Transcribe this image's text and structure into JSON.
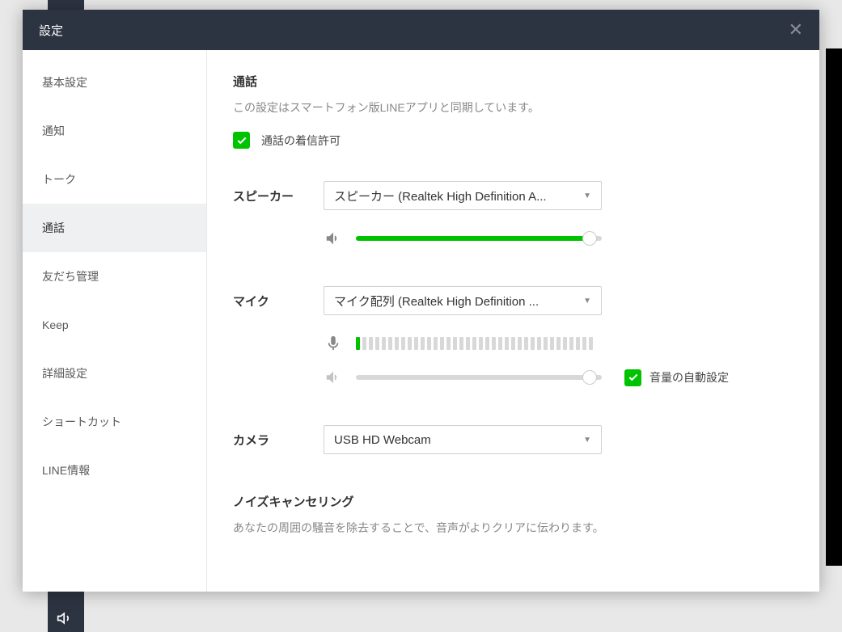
{
  "modal": {
    "title": "設定"
  },
  "sidebar": {
    "items": [
      {
        "label": "基本設定",
        "active": false
      },
      {
        "label": "通知",
        "active": false
      },
      {
        "label": "トーク",
        "active": false
      },
      {
        "label": "通話",
        "active": true
      },
      {
        "label": "友だち管理",
        "active": false
      },
      {
        "label": "Keep",
        "active": false
      },
      {
        "label": "詳細設定",
        "active": false
      },
      {
        "label": "ショートカット",
        "active": false
      },
      {
        "label": "LINE情報",
        "active": false
      }
    ]
  },
  "call": {
    "title": "通話",
    "description": "この設定はスマートフォン版LINEアプリと同期しています。",
    "allow_incoming_label": "通話の着信許可"
  },
  "speaker": {
    "label": "スピーカー",
    "selected": "スピーカー (Realtek High Definition A...",
    "volume_percent": 95
  },
  "mic": {
    "label": "マイク",
    "selected": "マイク配列 (Realtek High Definition ...",
    "level_active_bars": 1,
    "level_total_bars": 37,
    "volume_percent": 95,
    "auto_volume_label": "音量の自動設定"
  },
  "camera": {
    "label": "カメラ",
    "selected": "USB HD Webcam"
  },
  "noise": {
    "title": "ノイズキャンセリング",
    "description": "あなたの周囲の騒音を除去することで、音声がよりクリアに伝わります。"
  }
}
